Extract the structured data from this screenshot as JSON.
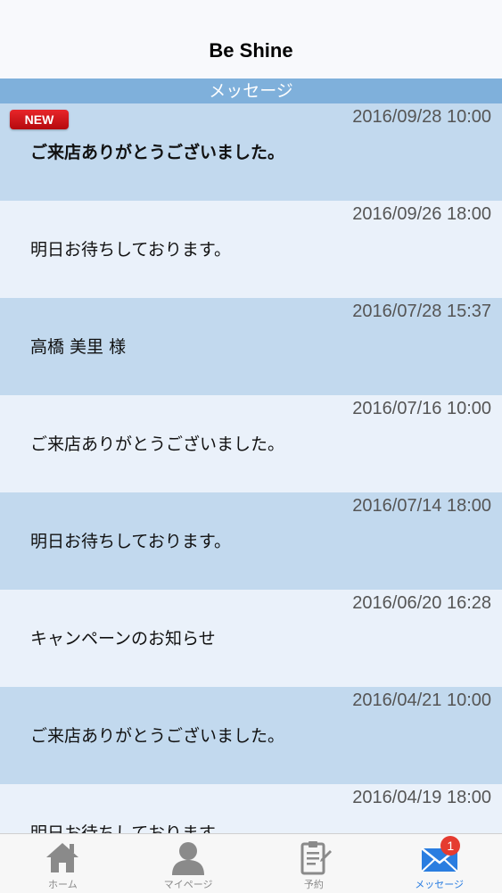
{
  "header": {
    "title": "Be Shine"
  },
  "section": {
    "title": "メッセージ"
  },
  "badge": {
    "new_label": "NEW"
  },
  "messages": [
    {
      "date": "2016/09/28 10:00",
      "title": "ご来店ありがとうございました。"
    },
    {
      "date": "2016/09/26 18:00",
      "title": "明日お待ちしております。"
    },
    {
      "date": "2016/07/28 15:37",
      "title": "高橋 美里 様"
    },
    {
      "date": "2016/07/16 10:00",
      "title": "ご来店ありがとうございました。"
    },
    {
      "date": "2016/07/14 18:00",
      "title": "明日お待ちしております。"
    },
    {
      "date": "2016/06/20 16:28",
      "title": "キャンペーンのお知らせ"
    },
    {
      "date": "2016/04/21 10:00",
      "title": "ご来店ありがとうございました。"
    },
    {
      "date": "2016/04/19 18:00",
      "title": "明日お待ちしております。"
    }
  ],
  "tabs": [
    {
      "label": "ホーム",
      "icon": "home-icon"
    },
    {
      "label": "マイページ",
      "icon": "person-icon"
    },
    {
      "label": "予約",
      "icon": "clipboard-icon"
    },
    {
      "label": "メッセージ",
      "icon": "envelope-icon",
      "badge": "1"
    }
  ],
  "colors": {
    "section_header": "#7fb0db",
    "row_shade_a": "#c2d9ee",
    "row_shade_b": "#eaf1fa",
    "tab_active": "#2a7de0",
    "badge_red": "#e53b30"
  }
}
